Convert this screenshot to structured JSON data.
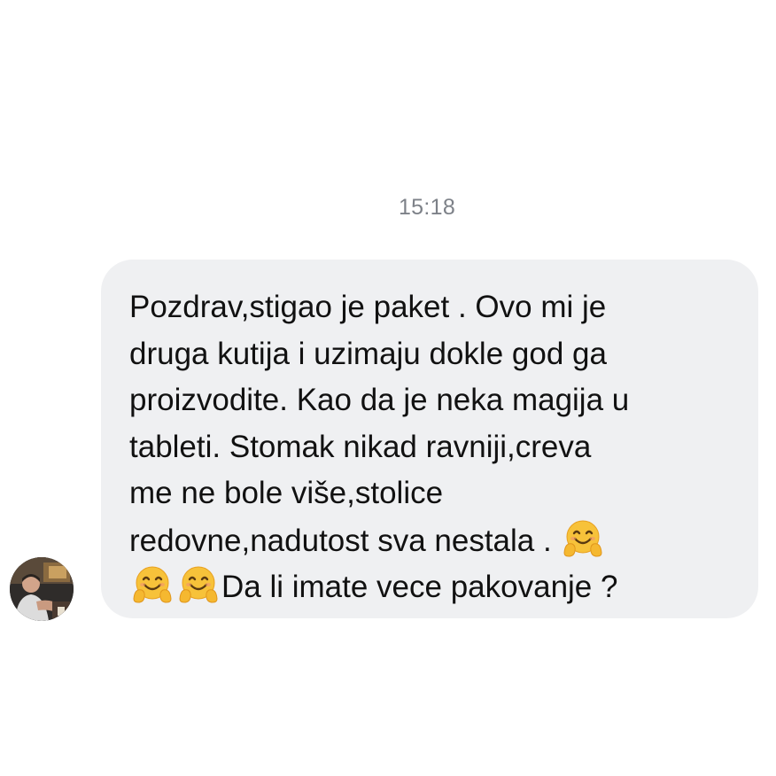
{
  "conversation": {
    "timestamp": "15:18",
    "message": {
      "lines": [
        "Pozdrav,stigao je paket . Ovo mi je",
        "druga kutija i uzimaju dokle god ga",
        "proizvodite.  Kao da je neka magija u",
        "tableti.  Stomak nikad ravniji,creva",
        "me ne bole više,stolice",
        "redovne,nadutost sva nestala . ",
        "Da li imate vece pakovanje ?"
      ],
      "emoji": "hugging-face-emoji",
      "bubble_color": "#eff0f2",
      "text_color": "#111111"
    },
    "timestamp_color": "#7d8188"
  }
}
